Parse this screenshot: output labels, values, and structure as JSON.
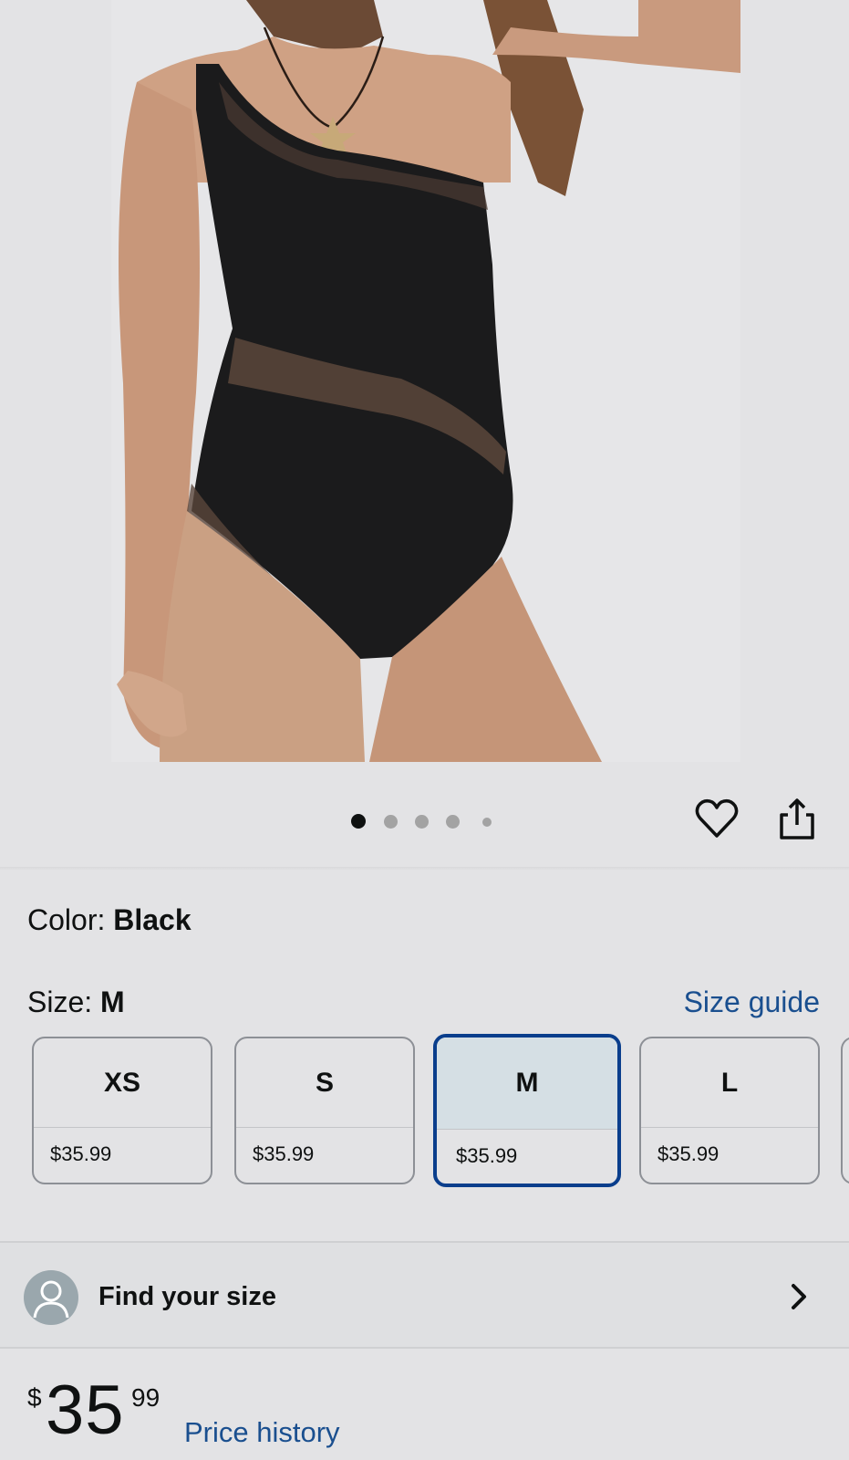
{
  "product_image": {
    "alt": "product-photo",
    "carousel": {
      "total": 5,
      "active_index": 0
    }
  },
  "actions": {
    "wishlist_icon": "heart-icon",
    "share_icon": "share-icon"
  },
  "color": {
    "label": "Color: ",
    "value": "Black"
  },
  "size": {
    "label": "Size: ",
    "value": "M",
    "guide_link": "Size guide",
    "options": [
      {
        "size": "XS",
        "price": "$35.99",
        "selected": false
      },
      {
        "size": "S",
        "price": "$35.99",
        "selected": false
      },
      {
        "size": "M",
        "price": "$35.99",
        "selected": true
      },
      {
        "size": "L",
        "price": "$35.99",
        "selected": false
      }
    ]
  },
  "find_size": {
    "label": "Find your size",
    "icon": "user-avatar-icon",
    "chevron": "chevron-right-icon"
  },
  "price": {
    "currency": "$",
    "whole": "35",
    "fraction": "99",
    "history_link": "Price history"
  },
  "colors": {
    "link": "#1a4f8f",
    "selected_border": "#0a3e8c",
    "selected_fill": "#d5dfe4",
    "background": "#e3e3e5"
  }
}
